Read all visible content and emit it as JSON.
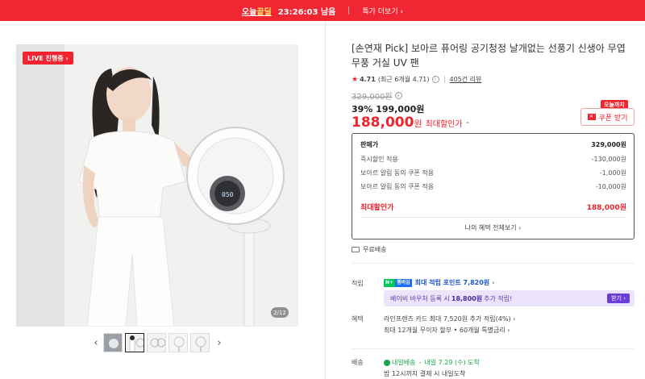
{
  "topbar": {
    "brand_a": "오늘",
    "brand_b": "끝딜",
    "timer": "23:26:03 남음",
    "more": "특가 더보기 ›"
  },
  "gallery": {
    "live": "LIVE 진행중 ›",
    "counter": "2/12",
    "prev": "‹",
    "next": "›"
  },
  "product": {
    "title": "[손연재 Pick] 보아르 퓨어링 공기청정 날개없는 선풍기 신생아 무엽 무풍 거실 UV 팬",
    "rating": "4.71",
    "rating_recent": "(최근 6개월 4.71)",
    "reviews": "405건 리뷰"
  },
  "price": {
    "original": "329,000원",
    "sale": "39% 199,000원",
    "final_amount": "188,000",
    "final_won": "원",
    "final_label": "최대할인가",
    "coupon_tag": "오늘까지",
    "coupon_btn": "쿠폰 받기"
  },
  "price_box": {
    "rows": [
      {
        "label": "판매가",
        "value": "329,000원"
      },
      {
        "label": "즉시할인 적용",
        "value": "-130,000원"
      },
      {
        "label": "보아르 알림 동의 쿠폰 적용",
        "value": "-1,000원"
      },
      {
        "label": "보아르 알림 동의 쿠폰 적용",
        "value": "-10,000원"
      }
    ],
    "best_label": "최대할인가",
    "best_value": "188,000원",
    "link": "나의 혜택 전체보기 ›"
  },
  "delivery_free": "무료배송",
  "points": {
    "label": "적립",
    "npay_a": "N+",
    "npay_b": "멤버십",
    "text": "최대 적립 포인트 7,820원",
    "chev": "›"
  },
  "voucher": {
    "text_a": "베이비 바우처 등록 시",
    "text_b": "18,800원",
    "text_c": "추가 적립!",
    "btn": "받기 ›"
  },
  "benefit": {
    "label": "혜택",
    "line1": "라인프렌즈 카드 최대 7,520원 추가 적립(4%) ›",
    "line2": "최대 12개월 무이자 할부 • 60개월 특별금리 ›"
  },
  "shipping": {
    "label": "배송",
    "type": "내일배송",
    "eta": "내일 7.29 (수) 도착",
    "note": "밤 12시까지 결제 시 내일도착"
  }
}
